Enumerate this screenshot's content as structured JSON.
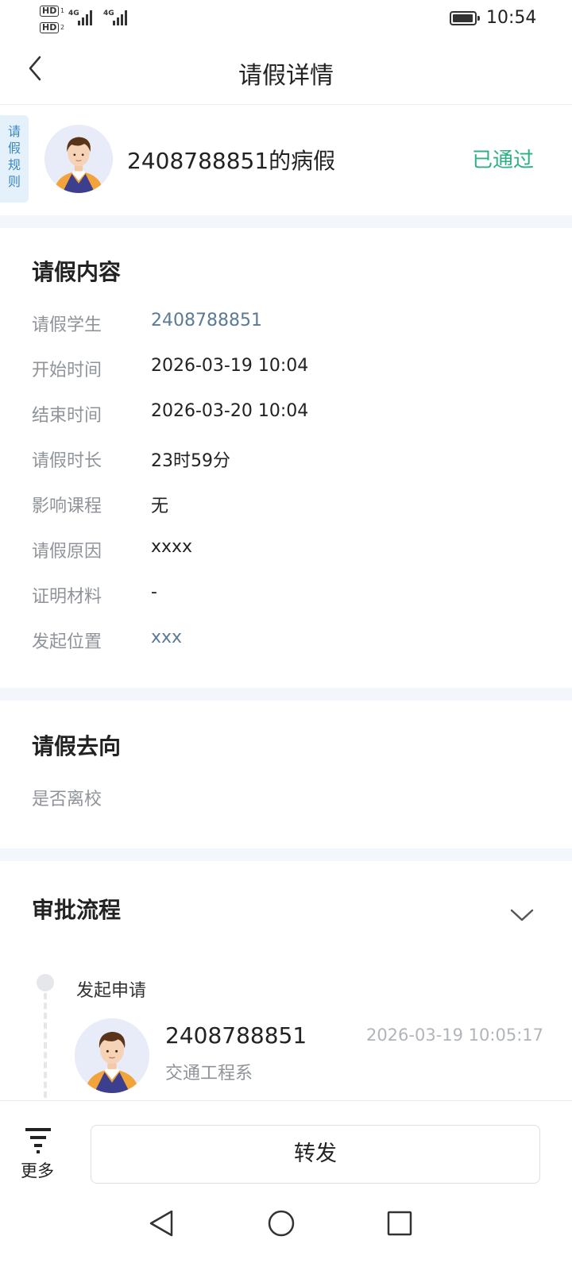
{
  "status_bar": {
    "sim1": "HD",
    "sim2": "HD",
    "sim1_slot": "1",
    "sim2_slot": "2",
    "network1": "4G",
    "network2": "4G",
    "battery_level": 0.95,
    "time": "10:54"
  },
  "nav": {
    "title": "请假详情",
    "back_icon": "chevron-left-icon"
  },
  "header": {
    "rules_tab": [
      "请",
      "假",
      "规",
      "则"
    ],
    "title": "2408788851的病假",
    "status": "已通过",
    "status_color": "#2eb085"
  },
  "content": {
    "title": "请假内容",
    "rows": [
      {
        "label": "请假学生",
        "value": "2408788851"
      },
      {
        "label": "开始时间",
        "value": "2026-03-19 10:04"
      },
      {
        "label": "结束时间",
        "value": "2026-03-20 10:04"
      },
      {
        "label": "请假时长",
        "value": "23时59分"
      },
      {
        "label": "影响课程",
        "value": "无"
      },
      {
        "label": "请假原因",
        "value": "xxxx"
      },
      {
        "label": "证明材料",
        "value": "-"
      },
      {
        "label": "发起位置",
        "value": "xxx"
      }
    ]
  },
  "destination": {
    "title": "请假去向",
    "leave_school_label": "是否离校"
  },
  "approval": {
    "title": "审批流程",
    "step": "发起申请",
    "approver": {
      "name": "2408788851",
      "department": "交通工程系",
      "time": "2026-03-19 10:05:17"
    }
  },
  "bottom": {
    "more_label": "更多",
    "forward_label": "转发"
  },
  "colors": {
    "link": "#5b7a95",
    "divider": "#f3f7fb",
    "rules_tab_bg": "#e4f0fa",
    "rules_tab_text": "#3a86c8"
  }
}
